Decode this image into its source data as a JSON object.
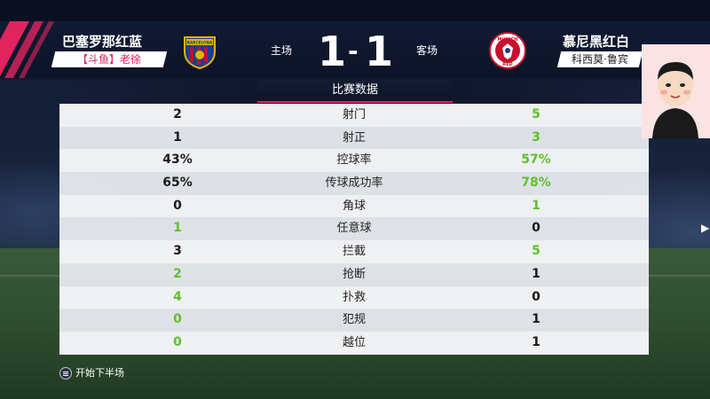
{
  "match": {
    "home": {
      "team": "巴塞罗那红蓝",
      "tag": "【斗鱼】老徐",
      "side": "主场",
      "score": "1",
      "crest_text": "BARCELONA"
    },
    "away": {
      "team": "慕尼黑红白",
      "tag": "科西莫·鲁宾",
      "side": "客场",
      "score": "1",
      "crest_text_top": "MUNICH",
      "crest_text_bottom": "RED"
    },
    "separator": "-"
  },
  "stats_title": "比赛数据",
  "stats": [
    {
      "label": "射门",
      "home": "2",
      "away": "5",
      "leader": "away"
    },
    {
      "label": "射正",
      "home": "1",
      "away": "3",
      "leader": "away"
    },
    {
      "label": "控球率",
      "home": "43%",
      "away": "57%",
      "leader": "away"
    },
    {
      "label": "传球成功率",
      "home": "65%",
      "away": "78%",
      "leader": "away"
    },
    {
      "label": "角球",
      "home": "0",
      "away": "1",
      "leader": "away"
    },
    {
      "label": "任意球",
      "home": "1",
      "away": "0",
      "leader": "home"
    },
    {
      "label": "拦截",
      "home": "3",
      "away": "5",
      "leader": "away"
    },
    {
      "label": "抢断",
      "home": "2",
      "away": "1",
      "leader": "home"
    },
    {
      "label": "扑救",
      "home": "4",
      "away": "0",
      "leader": "home"
    },
    {
      "label": "犯规",
      "home": "0",
      "away": "1",
      "leader": "home"
    },
    {
      "label": "越位",
      "home": "0",
      "away": "1",
      "leader": "home"
    }
  ],
  "footer": {
    "action_label": "开始下半场",
    "button_icon": "menu-button-icon"
  },
  "colors": {
    "accent": "#e0245e",
    "leader_green": "#5ec12c",
    "header_bg": "#101a33"
  }
}
